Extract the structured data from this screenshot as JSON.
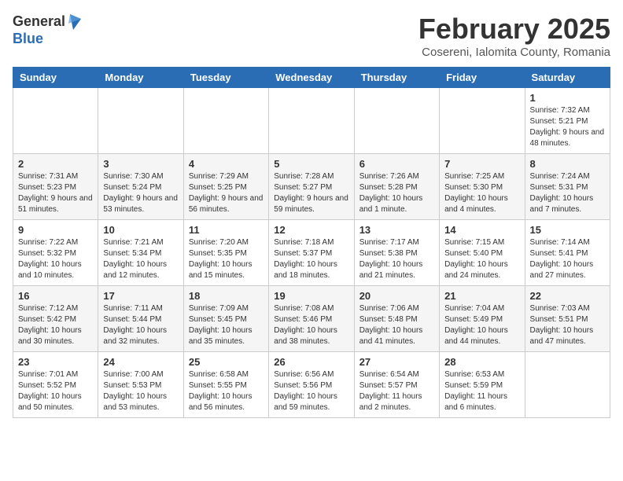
{
  "header": {
    "logo_general": "General",
    "logo_blue": "Blue",
    "month_title": "February 2025",
    "location": "Cosereni, Ialomita County, Romania"
  },
  "weekdays": [
    "Sunday",
    "Monday",
    "Tuesday",
    "Wednesday",
    "Thursday",
    "Friday",
    "Saturday"
  ],
  "weeks": [
    [
      {
        "day": "",
        "info": ""
      },
      {
        "day": "",
        "info": ""
      },
      {
        "day": "",
        "info": ""
      },
      {
        "day": "",
        "info": ""
      },
      {
        "day": "",
        "info": ""
      },
      {
        "day": "",
        "info": ""
      },
      {
        "day": "1",
        "info": "Sunrise: 7:32 AM\nSunset: 5:21 PM\nDaylight: 9 hours and 48 minutes."
      }
    ],
    [
      {
        "day": "2",
        "info": "Sunrise: 7:31 AM\nSunset: 5:23 PM\nDaylight: 9 hours and 51 minutes."
      },
      {
        "day": "3",
        "info": "Sunrise: 7:30 AM\nSunset: 5:24 PM\nDaylight: 9 hours and 53 minutes."
      },
      {
        "day": "4",
        "info": "Sunrise: 7:29 AM\nSunset: 5:25 PM\nDaylight: 9 hours and 56 minutes."
      },
      {
        "day": "5",
        "info": "Sunrise: 7:28 AM\nSunset: 5:27 PM\nDaylight: 9 hours and 59 minutes."
      },
      {
        "day": "6",
        "info": "Sunrise: 7:26 AM\nSunset: 5:28 PM\nDaylight: 10 hours and 1 minute."
      },
      {
        "day": "7",
        "info": "Sunrise: 7:25 AM\nSunset: 5:30 PM\nDaylight: 10 hours and 4 minutes."
      },
      {
        "day": "8",
        "info": "Sunrise: 7:24 AM\nSunset: 5:31 PM\nDaylight: 10 hours and 7 minutes."
      }
    ],
    [
      {
        "day": "9",
        "info": "Sunrise: 7:22 AM\nSunset: 5:32 PM\nDaylight: 10 hours and 10 minutes."
      },
      {
        "day": "10",
        "info": "Sunrise: 7:21 AM\nSunset: 5:34 PM\nDaylight: 10 hours and 12 minutes."
      },
      {
        "day": "11",
        "info": "Sunrise: 7:20 AM\nSunset: 5:35 PM\nDaylight: 10 hours and 15 minutes."
      },
      {
        "day": "12",
        "info": "Sunrise: 7:18 AM\nSunset: 5:37 PM\nDaylight: 10 hours and 18 minutes."
      },
      {
        "day": "13",
        "info": "Sunrise: 7:17 AM\nSunset: 5:38 PM\nDaylight: 10 hours and 21 minutes."
      },
      {
        "day": "14",
        "info": "Sunrise: 7:15 AM\nSunset: 5:40 PM\nDaylight: 10 hours and 24 minutes."
      },
      {
        "day": "15",
        "info": "Sunrise: 7:14 AM\nSunset: 5:41 PM\nDaylight: 10 hours and 27 minutes."
      }
    ],
    [
      {
        "day": "16",
        "info": "Sunrise: 7:12 AM\nSunset: 5:42 PM\nDaylight: 10 hours and 30 minutes."
      },
      {
        "day": "17",
        "info": "Sunrise: 7:11 AM\nSunset: 5:44 PM\nDaylight: 10 hours and 32 minutes."
      },
      {
        "day": "18",
        "info": "Sunrise: 7:09 AM\nSunset: 5:45 PM\nDaylight: 10 hours and 35 minutes."
      },
      {
        "day": "19",
        "info": "Sunrise: 7:08 AM\nSunset: 5:46 PM\nDaylight: 10 hours and 38 minutes."
      },
      {
        "day": "20",
        "info": "Sunrise: 7:06 AM\nSunset: 5:48 PM\nDaylight: 10 hours and 41 minutes."
      },
      {
        "day": "21",
        "info": "Sunrise: 7:04 AM\nSunset: 5:49 PM\nDaylight: 10 hours and 44 minutes."
      },
      {
        "day": "22",
        "info": "Sunrise: 7:03 AM\nSunset: 5:51 PM\nDaylight: 10 hours and 47 minutes."
      }
    ],
    [
      {
        "day": "23",
        "info": "Sunrise: 7:01 AM\nSunset: 5:52 PM\nDaylight: 10 hours and 50 minutes."
      },
      {
        "day": "24",
        "info": "Sunrise: 7:00 AM\nSunset: 5:53 PM\nDaylight: 10 hours and 53 minutes."
      },
      {
        "day": "25",
        "info": "Sunrise: 6:58 AM\nSunset: 5:55 PM\nDaylight: 10 hours and 56 minutes."
      },
      {
        "day": "26",
        "info": "Sunrise: 6:56 AM\nSunset: 5:56 PM\nDaylight: 10 hours and 59 minutes."
      },
      {
        "day": "27",
        "info": "Sunrise: 6:54 AM\nSunset: 5:57 PM\nDaylight: 11 hours and 2 minutes."
      },
      {
        "day": "28",
        "info": "Sunrise: 6:53 AM\nSunset: 5:59 PM\nDaylight: 11 hours and 6 minutes."
      },
      {
        "day": "",
        "info": ""
      }
    ]
  ]
}
